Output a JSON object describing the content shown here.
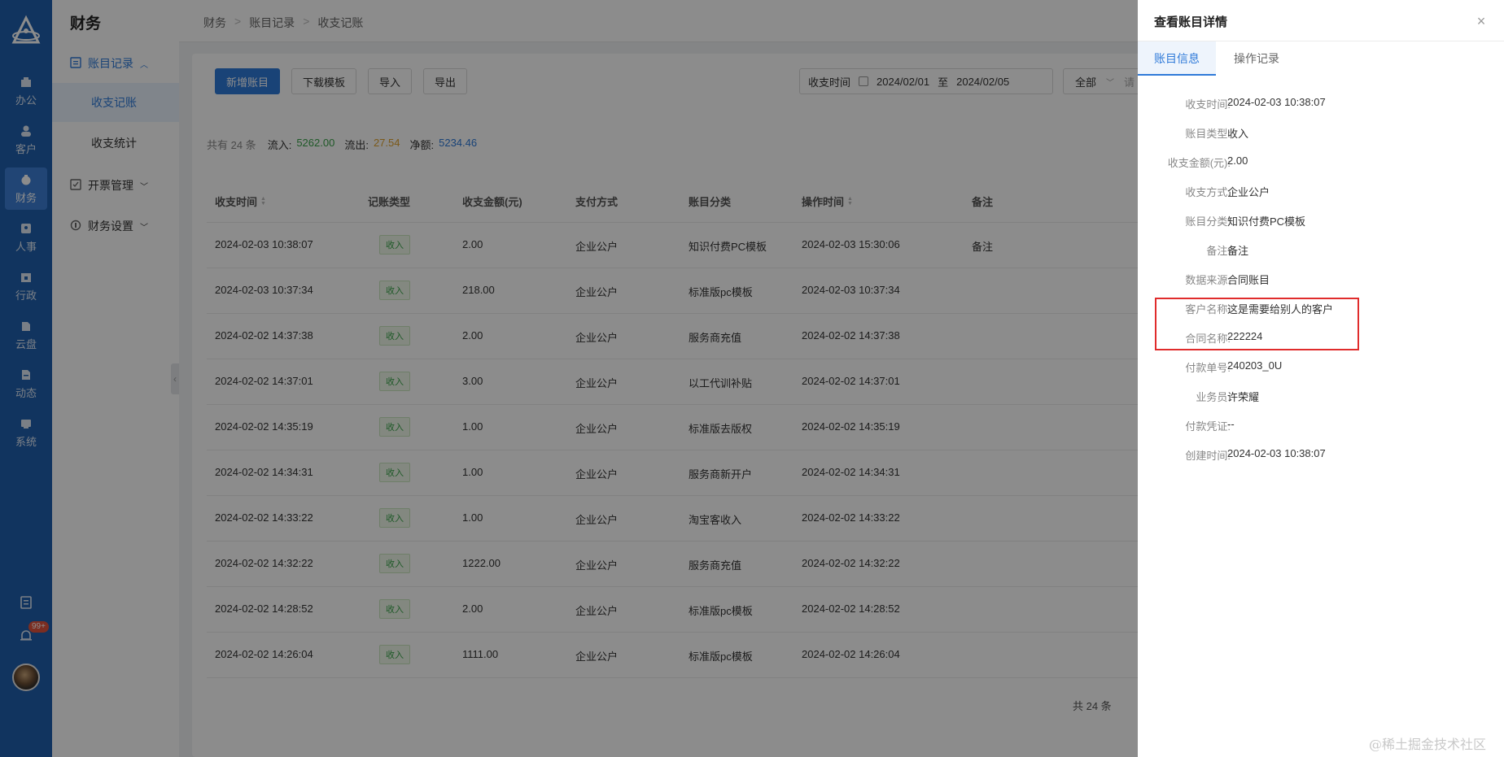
{
  "app": {
    "module_title": "财务"
  },
  "rail": {
    "items": [
      {
        "label": "办公"
      },
      {
        "label": "客户"
      },
      {
        "label": "财务"
      },
      {
        "label": "人事"
      },
      {
        "label": "行政"
      },
      {
        "label": "云盘"
      },
      {
        "label": "动态"
      },
      {
        "label": "系统"
      }
    ],
    "notification_badge": "99+"
  },
  "sidebar": {
    "groups": [
      {
        "label": "账目记录",
        "subitems": [
          "收支记账",
          "收支统计"
        ]
      },
      {
        "label": "开票管理"
      },
      {
        "label": "财务设置"
      }
    ]
  },
  "breadcrumb": [
    "财务",
    "账目记录",
    "收支记账"
  ],
  "toolbar": {
    "add": "新增账目",
    "template": "下载模板",
    "import": "导入",
    "export": "导出",
    "date_label": "收支时间",
    "date_start": "2024/02/01",
    "date_sep": "至",
    "date_end": "2024/02/05",
    "filter_value": "全部",
    "filter_hint": "请"
  },
  "summary": {
    "count_text": "共有 24 条",
    "inflow_label": "流入:",
    "inflow": "5262.00",
    "outflow_label": "流出:",
    "outflow": "27.54",
    "net_label": "净额:",
    "net": "5234.46"
  },
  "table": {
    "headers": [
      "收支时间",
      "记账类型",
      "收支金额(元)",
      "支付方式",
      "账目分类",
      "操作时间",
      "备注"
    ],
    "rows": [
      {
        "time": "2024-02-03 10:38:07",
        "type": "收入",
        "amount": "2.00",
        "method": "企业公户",
        "category": "知识付费PC模板",
        "op_time": "2024-02-03 15:30:06",
        "remark": "备注"
      },
      {
        "time": "2024-02-03 10:37:34",
        "type": "收入",
        "amount": "218.00",
        "method": "企业公户",
        "category": "标准版pc模板",
        "op_time": "2024-02-03 10:37:34",
        "remark": ""
      },
      {
        "time": "2024-02-02 14:37:38",
        "type": "收入",
        "amount": "2.00",
        "method": "企业公户",
        "category": "服务商充值",
        "op_time": "2024-02-02 14:37:38",
        "remark": ""
      },
      {
        "time": "2024-02-02 14:37:01",
        "type": "收入",
        "amount": "3.00",
        "method": "企业公户",
        "category": "以工代训补贴",
        "op_time": "2024-02-02 14:37:01",
        "remark": ""
      },
      {
        "time": "2024-02-02 14:35:19",
        "type": "收入",
        "amount": "1.00",
        "method": "企业公户",
        "category": "标准版去版权",
        "op_time": "2024-02-02 14:35:19",
        "remark": ""
      },
      {
        "time": "2024-02-02 14:34:31",
        "type": "收入",
        "amount": "1.00",
        "method": "企业公户",
        "category": "服务商新开户",
        "op_time": "2024-02-02 14:34:31",
        "remark": ""
      },
      {
        "time": "2024-02-02 14:33:22",
        "type": "收入",
        "amount": "1.00",
        "method": "企业公户",
        "category": "淘宝客收入",
        "op_time": "2024-02-02 14:33:22",
        "remark": ""
      },
      {
        "time": "2024-02-02 14:32:22",
        "type": "收入",
        "amount": "1222.00",
        "method": "企业公户",
        "category": "服务商充值",
        "op_time": "2024-02-02 14:32:22",
        "remark": ""
      },
      {
        "time": "2024-02-02 14:28:52",
        "type": "收入",
        "amount": "2.00",
        "method": "企业公户",
        "category": "标准版pc模板",
        "op_time": "2024-02-02 14:28:52",
        "remark": ""
      },
      {
        "time": "2024-02-02 14:26:04",
        "type": "收入",
        "amount": "1111.00",
        "method": "企业公户",
        "category": "标准版pc模板",
        "op_time": "2024-02-02 14:26:04",
        "remark": ""
      }
    ],
    "total_text": "共 24 条"
  },
  "drawer": {
    "title": "查看账目详情",
    "close": "×",
    "tabs": [
      "账目信息",
      "操作记录"
    ],
    "fields": [
      {
        "label": "收支时间:",
        "value": "2024-02-03 10:38:07"
      },
      {
        "label": "账目类型:",
        "value": "收入"
      },
      {
        "label": "收支金额(元):",
        "value": "2.00"
      },
      {
        "label": "收支方式:",
        "value": "企业公户"
      },
      {
        "label": "账目分类:",
        "value": "知识付费PC模板"
      },
      {
        "label": "备注:",
        "value": "备注"
      },
      {
        "label": "数据来源:",
        "value": "合同账目"
      },
      {
        "label": "客户名称:",
        "value": "这是需要给别人的客户"
      },
      {
        "label": "合同名称:",
        "value": "222224"
      },
      {
        "label": "付款单号:",
        "value": "240203_0U"
      },
      {
        "label": "业务员:",
        "value": "许荣耀"
      },
      {
        "label": "付款凭证:",
        "value": "--"
      },
      {
        "label": "创建时间:",
        "value": "2024-02-03 10:38:07"
      }
    ]
  },
  "watermark": "@稀土掘金技术社区",
  "colors": {
    "rail": "#1f5fae",
    "primary": "#2f7ad9",
    "inflow": "#3aa34a",
    "outflow": "#e0a32f",
    "highlight": "#e02c2c"
  }
}
